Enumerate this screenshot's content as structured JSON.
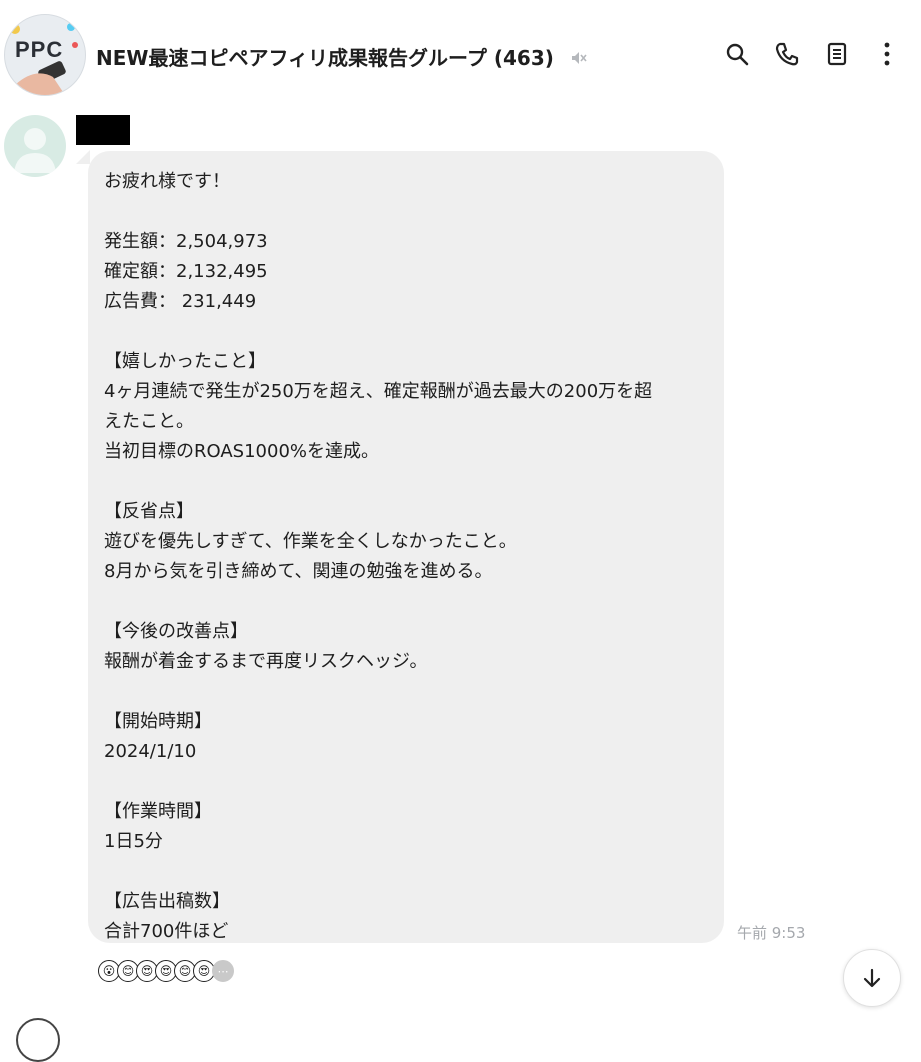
{
  "header": {
    "title": "NEW最速コピペアフィリ成果報告グループ",
    "member_count": "(463)",
    "avatar_text": "PPC",
    "icons": [
      "search-icon",
      "call-icon",
      "notes-icon",
      "more-icon",
      "mute-icon"
    ]
  },
  "message": {
    "lines": [
      "お疲れ様です！",
      "",
      "発生額：2,504,973",
      "確定額：2,132,495",
      "広告費： 231,449",
      "",
      "【嬉しかったこと】",
      "4ヶ月連続で発生が250万を超え、確定報酬が過去最大の200万を超",
      "えたこと。",
      "当初目標のROAS1000%を達成。",
      "",
      "【反省点】",
      "遊びを優先しすぎて、作業を全くしなかったこと。",
      "8月から気を引き締めて、関連の勉強を進める。",
      "",
      "【今後の改善点】",
      "報酬が着金するまで再度リスクヘッジ。",
      "",
      "【開始時期】",
      "2024/1/10",
      "",
      "【作業時間】",
      "1日5分",
      "",
      "【広告出稿数】",
      "合計700件ほど"
    ],
    "timestamp": "午前 9:53"
  },
  "reactions": {
    "items": [
      "😮",
      "😊",
      "😍",
      "😍",
      "😊",
      "😍"
    ],
    "more": "⋯"
  },
  "colors": {
    "bubble": "#efefef",
    "timestamp": "#a5a8ad",
    "text": "#1e1e1e"
  }
}
